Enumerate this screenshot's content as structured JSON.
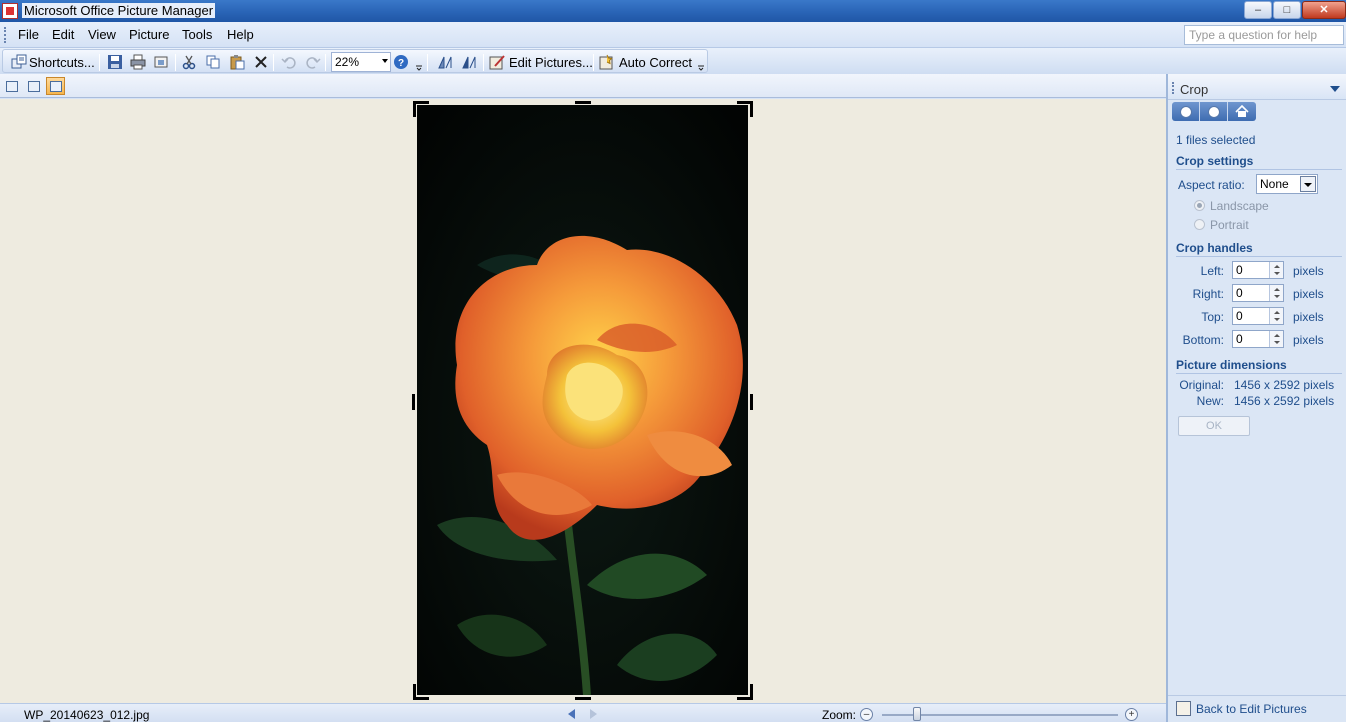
{
  "window": {
    "title": "Microsoft Office Picture Manager",
    "minimize": "–",
    "maximize": "□",
    "close": "✕"
  },
  "menu": {
    "items": [
      "File",
      "Edit",
      "View",
      "Picture",
      "Tools",
      "Help"
    ],
    "help_placeholder": "Type a question for help"
  },
  "toolbar": {
    "shortcuts_label": "Shortcuts...",
    "zoom_value": "22%",
    "edit_pictures_label": "Edit Pictures...",
    "auto_correct_label": "Auto Correct",
    "icons": [
      "shortcuts-icon",
      "save-icon",
      "print-icon",
      "email-icon",
      "cut-icon",
      "copy-icon",
      "paste-icon",
      "delete-icon",
      "undo-icon",
      "redo-icon",
      "help-icon",
      "rotate-left-icon",
      "rotate-right-icon",
      "edit-pictures-icon",
      "auto-correct-icon"
    ]
  },
  "viewbar": {
    "views": [
      "thumbnail-view",
      "filmstrip-view",
      "single-picture-view"
    ],
    "active_view": "single-picture-view"
  },
  "status": {
    "filename": "WP_20140623_012.jpg",
    "zoom_label": "Zoom:",
    "zoom_fraction": 0.15
  },
  "taskpane": {
    "title": "Crop",
    "files_selected": "1 files selected",
    "crop_settings_heading": "Crop settings",
    "aspect_ratio_label": "Aspect ratio:",
    "aspect_ratio_value": "None",
    "landscape_label": "Landscape",
    "portrait_label": "Portrait",
    "crop_handles_heading": "Crop handles",
    "handles": [
      {
        "label": "Left:",
        "value": "0",
        "unit": "pixels"
      },
      {
        "label": "Right:",
        "value": "0",
        "unit": "pixels"
      },
      {
        "label": "Top:",
        "value": "0",
        "unit": "pixels"
      },
      {
        "label": "Bottom:",
        "value": "0",
        "unit": "pixels"
      }
    ],
    "dimensions_heading": "Picture dimensions",
    "original_label": "Original:",
    "original_value": "1456 x 2592 pixels",
    "new_label": "New:",
    "new_value": "1456 x 2592 pixels",
    "ok_label": "OK",
    "back_link": "Back to Edit Pictures"
  }
}
